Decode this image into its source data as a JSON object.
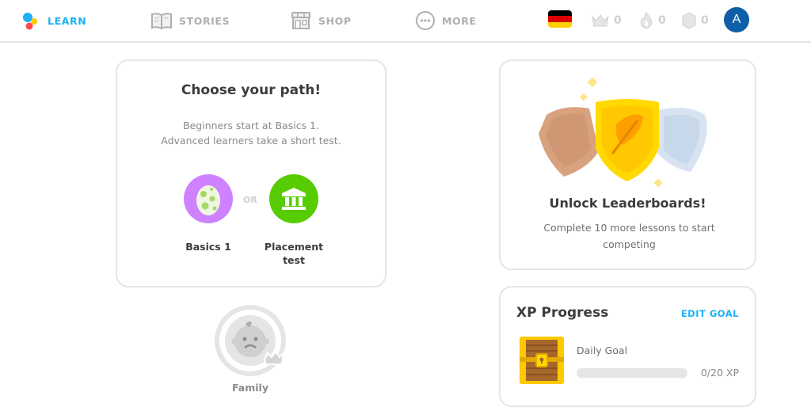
{
  "nav": {
    "learn": "LEARN",
    "stories": "STORIES",
    "shop": "SHOP",
    "more": "MORE"
  },
  "stats": {
    "crowns": "0",
    "streak": "0",
    "gems": "0"
  },
  "user": {
    "avatar_letter": "A"
  },
  "path_card": {
    "title": "Choose your path!",
    "desc_line1": "Beginners start at Basics 1.",
    "desc_line2": "Advanced learners take a short test.",
    "or": "OR",
    "basics_label": "Basics 1",
    "placement_line1": "Placement",
    "placement_line2": "test"
  },
  "family": {
    "label": "Family"
  },
  "leaderboard": {
    "title": "Unlock Leaderboards!",
    "desc": "Complete 10 more lessons to start competing"
  },
  "xp": {
    "title": "XP Progress",
    "edit_goal": "EDIT GOAL",
    "goal_label": "Daily Goal",
    "progress_text": "0/20 XP",
    "progress_fraction": 0
  },
  "colors": {
    "accent_blue": "#1cb0f6",
    "basics_purple": "#ce82ff",
    "placement_green": "#58cc02",
    "avatar_blue": "#0f5ea8"
  },
  "icons": {
    "learn": "learn-dots-icon",
    "stories": "book-icon",
    "shop": "shop-icon",
    "more": "more-dots-icon",
    "flag": "german-flag-icon",
    "crown": "crown-icon",
    "streak": "flame-icon",
    "gems": "gem-icon"
  }
}
